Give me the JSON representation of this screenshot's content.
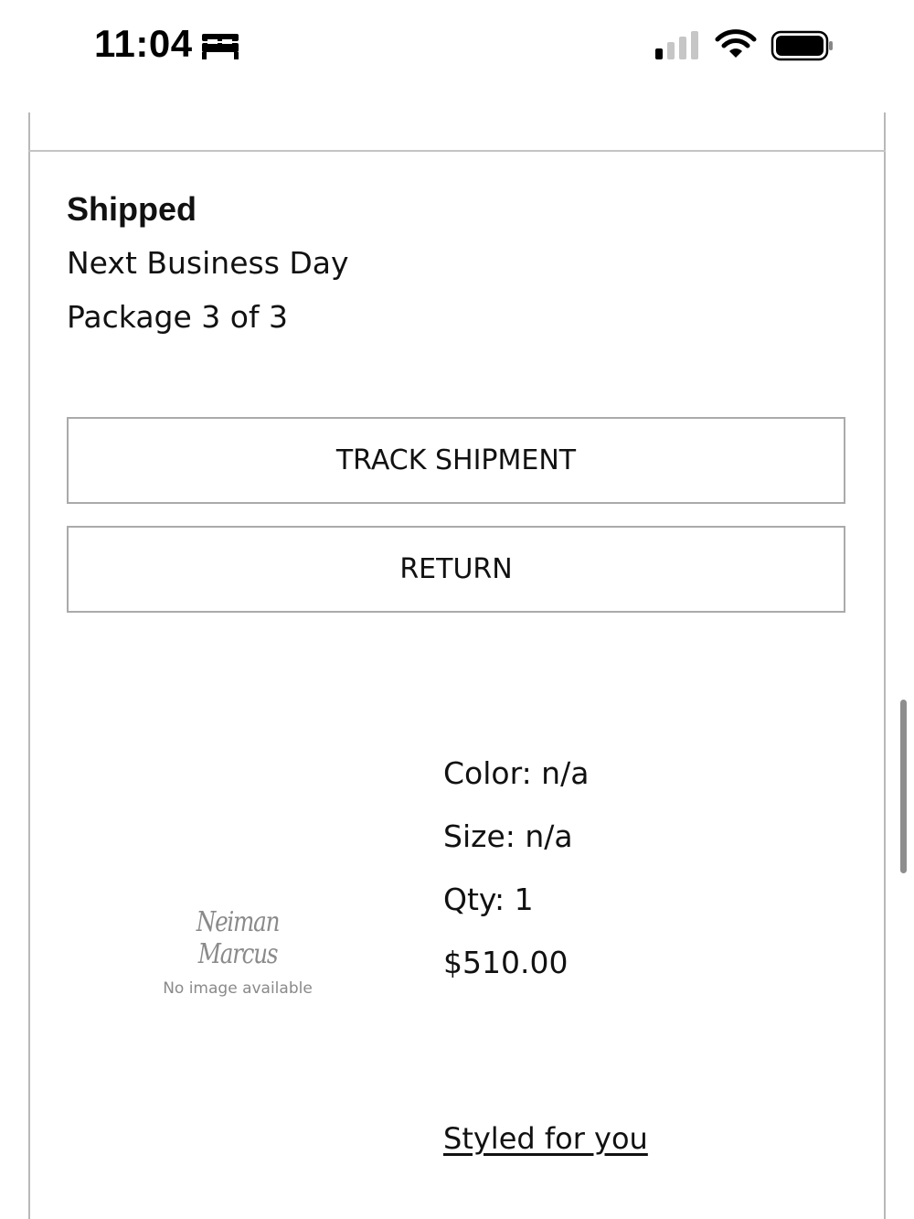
{
  "status_bar": {
    "time": "11:04",
    "focus_icon": "bed-icon",
    "signal_icon": "cellular-signal-icon",
    "wifi_icon": "wifi-icon",
    "battery_icon": "battery-icon"
  },
  "shipment": {
    "status": "Shipped",
    "method": "Next Business Day",
    "package": "Package 3 of 3"
  },
  "actions": {
    "track_label": "TRACK SHIPMENT",
    "return_label": "RETURN"
  },
  "product": {
    "image_brand": "Neiman Marcus",
    "image_placeholder": "No image available",
    "color": "Color: n/a",
    "size": "Size: n/a",
    "qty": "Qty: 1",
    "price": "$510.00"
  },
  "links": {
    "styled_for_you": "Styled for you"
  }
}
